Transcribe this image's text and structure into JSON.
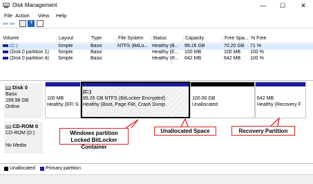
{
  "window": {
    "title": "Disk Management",
    "minimize": "—",
    "maximize": "☐",
    "close": "✕"
  },
  "menu": {
    "file": "File",
    "action": "Action",
    "view": "View",
    "help": "Help"
  },
  "toolbar": {
    "back": "⇦",
    "forward": "⇨",
    "help": "?"
  },
  "volume_list": {
    "columns": [
      "Volume",
      "Layout",
      "Type",
      "File System",
      "Status",
      "Capacity",
      "Free Spa...",
      "% Free"
    ],
    "rows": [
      {
        "volume": "(C:)",
        "layout": "Simple",
        "type": "Basic",
        "fs": "NTFS (BitLo...",
        "status": "Healthy (B...",
        "capacity": "99.26 GB",
        "free": "70.20 GB",
        "pct": "71 %"
      },
      {
        "volume": "(Disk 0 partition 1)",
        "layout": "Simple",
        "type": "Basic",
        "fs": "",
        "status": "Healthy (E...",
        "capacity": "100 MB",
        "free": "100 MB",
        "pct": "100 %"
      },
      {
        "volume": "(Disk 0 partition 4)",
        "layout": "Simple",
        "type": "Basic",
        "fs": "",
        "status": "Healthy (R...",
        "capacity": "642 MB",
        "free": "642 MB",
        "pct": "100 %"
      }
    ]
  },
  "disk0": {
    "name": "Disk 0",
    "type": "Basic",
    "size": "199.98 GB",
    "state": "Online",
    "partitions": {
      "efi": {
        "size": "100 MB",
        "status": "Healthy (EFI S"
      },
      "c": {
        "name": "(C:)",
        "size": "99.26 GB NTFS (BitLocker Encrypted)",
        "status": "Healthy (Boot, Page File, Crash Dump"
      },
      "unalloc": {
        "size": "100.00 GB",
        "status": "Unallocated"
      },
      "recovery": {
        "size": "642 MB",
        "status": "Healthy (Recovery F"
      }
    }
  },
  "cdrom0": {
    "name": "CD-ROM 0",
    "drive": "CD-ROM (D:)",
    "media": "No Media"
  },
  "callouts": {
    "windows": "Windows partition\nLocked BitLocker Container",
    "windows_line1": "Windows partition",
    "windows_line2": "Locked BitLocker Container",
    "unallocated": "Unallocated Space",
    "recovery": "Recovery Partition"
  },
  "legend": {
    "unallocated": "Unallocated",
    "primary": "Primary partition"
  },
  "colors": {
    "primary_partition": "#1c1c9c",
    "unallocated": "#000000",
    "callout_border": "#d9231e"
  },
  "icons": [
    "disk-management-icon",
    "back-arrow-icon",
    "forward-arrow-icon",
    "properties-icon",
    "help-icon",
    "console-icon",
    "disk-icon",
    "cdrom-icon"
  ]
}
